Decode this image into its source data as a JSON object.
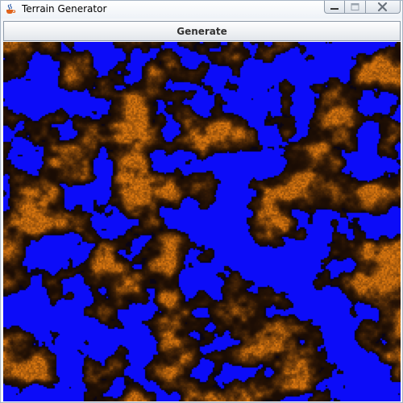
{
  "window": {
    "title": "Terrain Generator",
    "icon": "java-coffee-cup-icon",
    "controls": [
      "minimize-icon",
      "maximize-icon",
      "close-icon"
    ]
  },
  "toolbar": {
    "generate_label": "Generate"
  },
  "terrain": {
    "water_color": "#0c0cf8",
    "land_dark_color": "#1a0c04",
    "land_light_color": "#e07a10"
  }
}
